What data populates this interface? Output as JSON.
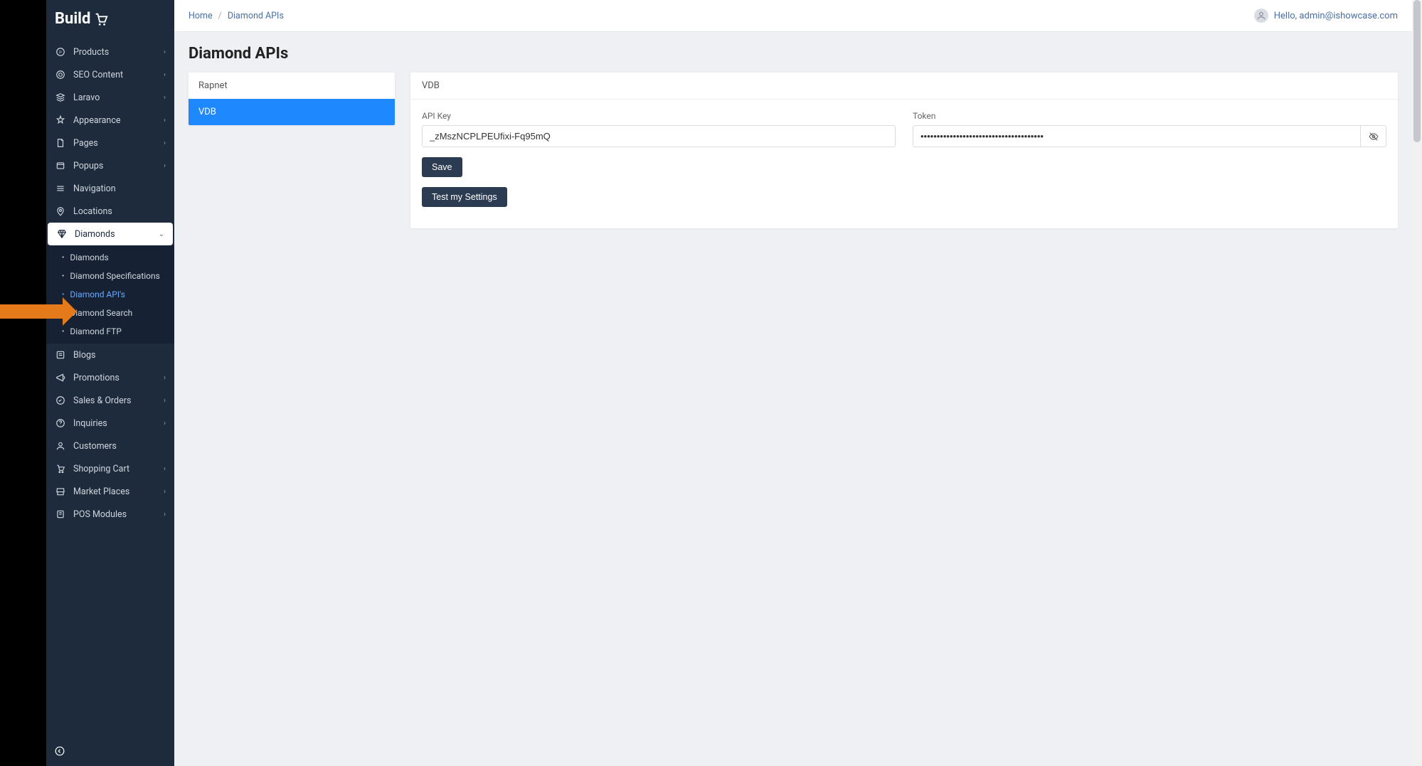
{
  "brand": "Build",
  "breadcrumb": {
    "home": "Home",
    "current": "Diamond APIs"
  },
  "user_greeting": "Hello, admin@ishowcase.com",
  "page_title": "Diamond APIs",
  "sidebar": {
    "items": [
      {
        "label": "Products",
        "icon": "product-icon",
        "expandable": true
      },
      {
        "label": "SEO Content",
        "icon": "seo-icon",
        "expandable": true
      },
      {
        "label": "Laravo",
        "icon": "laravo-icon",
        "expandable": true
      },
      {
        "label": "Appearance",
        "icon": "appearance-icon",
        "expandable": true
      },
      {
        "label": "Pages",
        "icon": "pages-icon",
        "expandable": true
      },
      {
        "label": "Popups",
        "icon": "popups-icon",
        "expandable": true
      },
      {
        "label": "Navigation",
        "icon": "nav-icon",
        "expandable": false
      },
      {
        "label": "Locations",
        "icon": "location-icon",
        "expandable": false
      },
      {
        "label": "Diamonds",
        "icon": "diamond-icon",
        "expandable": true,
        "active": true,
        "children": [
          {
            "label": "Diamonds"
          },
          {
            "label": "Diamond Specifications"
          },
          {
            "label": "Diamond API's",
            "selected": true
          },
          {
            "label": "Diamond Search"
          },
          {
            "label": "Diamond FTP"
          }
        ]
      },
      {
        "label": "Blogs",
        "icon": "blogs-icon",
        "expandable": false
      },
      {
        "label": "Promotions",
        "icon": "promo-icon",
        "expandable": true
      },
      {
        "label": "Sales & Orders",
        "icon": "orders-icon",
        "expandable": true
      },
      {
        "label": "Inquiries",
        "icon": "inquiries-icon",
        "expandable": true
      },
      {
        "label": "Customers",
        "icon": "customers-icon",
        "expandable": false
      },
      {
        "label": "Shopping Cart",
        "icon": "cart-icon",
        "expandable": true
      },
      {
        "label": "Market Places",
        "icon": "market-icon",
        "expandable": true
      },
      {
        "label": "POS Modules",
        "icon": "pos-icon",
        "expandable": true
      }
    ]
  },
  "tabs": [
    {
      "label": "Rapnet",
      "active": false
    },
    {
      "label": "VDB",
      "active": true
    }
  ],
  "form": {
    "header": "VDB",
    "api_key_label": "API Key",
    "api_key_value": "_zMszNCPLPEUfixi-Fq95mQ",
    "token_label": "Token",
    "token_value": "••••••••••••••••••••••••••••••••••••••",
    "save_label": "Save",
    "test_label": "Test my Settings"
  }
}
